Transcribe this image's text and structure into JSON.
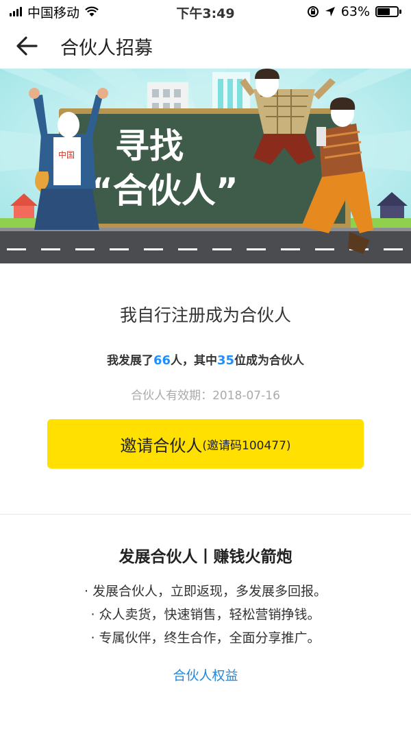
{
  "status_bar": {
    "carrier": "中国移动",
    "time": "下午3:49",
    "battery_percent": "63%",
    "battery_level": 0.63
  },
  "nav": {
    "title": "合伙人招募",
    "back_icon": "arrow-left-icon"
  },
  "banner": {
    "headline_1": "寻找",
    "headline_2": "“合伙人”",
    "badge_text": "中国"
  },
  "main": {
    "register_title": "我自行注册成为合伙人",
    "stats": {
      "prefix": "我发展了",
      "developed_count": "66",
      "middle": "人，其中",
      "partner_count": "35",
      "suffix": "位成为合伙人"
    },
    "validity": "合伙人有效期：2018-07-16",
    "invite_button": {
      "label": "邀请合伙人",
      "code_text": "(邀请码100477)"
    }
  },
  "benefits": {
    "title": "发展合伙人丨赚钱火箭炮",
    "items": [
      "· 发展合伙人，立即返现，多发展多回报。",
      "· 众人卖货，快速销售，轻松营销挣钱。",
      "· 专属伙伴，终生合作，全面分享推广。"
    ],
    "link_label": "合伙人权益"
  },
  "colors": {
    "accent_yellow": "#ffe000",
    "link_blue": "#1e88e5",
    "number_blue": "#1e90ff"
  }
}
